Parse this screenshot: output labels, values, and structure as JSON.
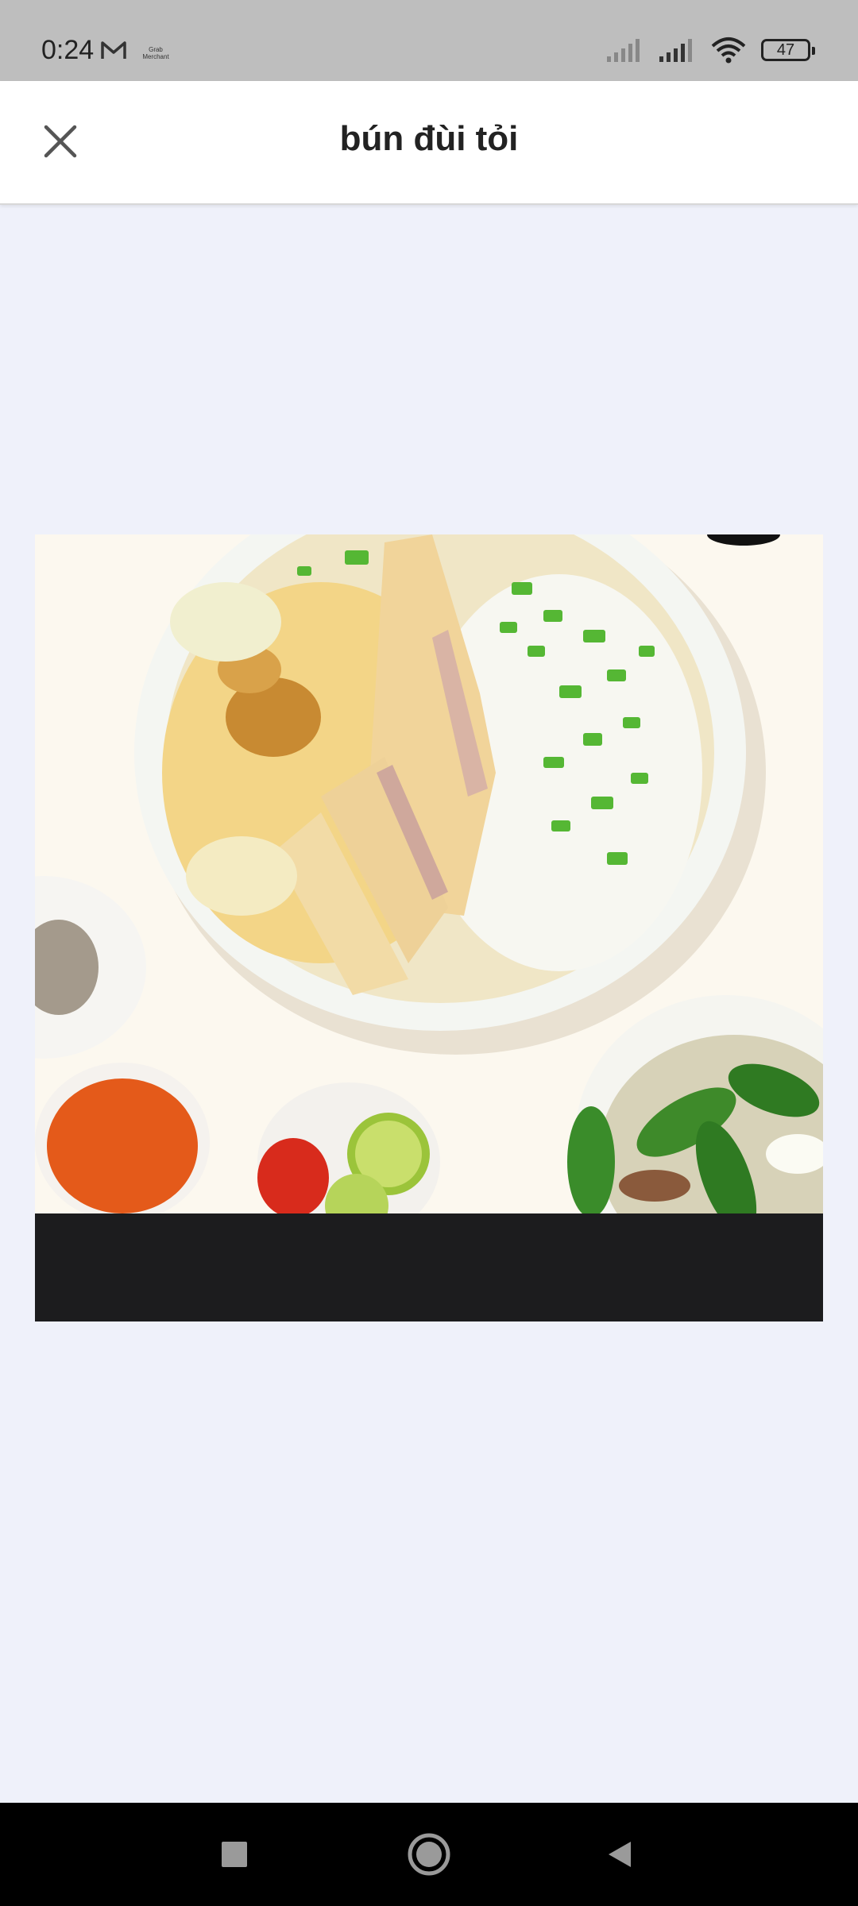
{
  "status_bar": {
    "time": "0:24",
    "carrier_text": "Grab Merchant",
    "battery_level": "47",
    "icons": [
      "mail-icon",
      "signal-icon",
      "signal-icon",
      "wifi-icon",
      "battery-icon"
    ]
  },
  "header": {
    "title": "bún đùi tỏi",
    "close_icon": "close-icon"
  },
  "media": {
    "image_subject": "chicken-noodle-soup-photo"
  },
  "nav_bar": {
    "buttons": [
      "recents-button",
      "home-button",
      "back-button"
    ]
  },
  "colors": {
    "background": "#eff1fa",
    "status_bar": "#bebebe",
    "header": "#ffffff",
    "media_letterbox": "#1c1c1e",
    "nav_bar": "#000000"
  }
}
